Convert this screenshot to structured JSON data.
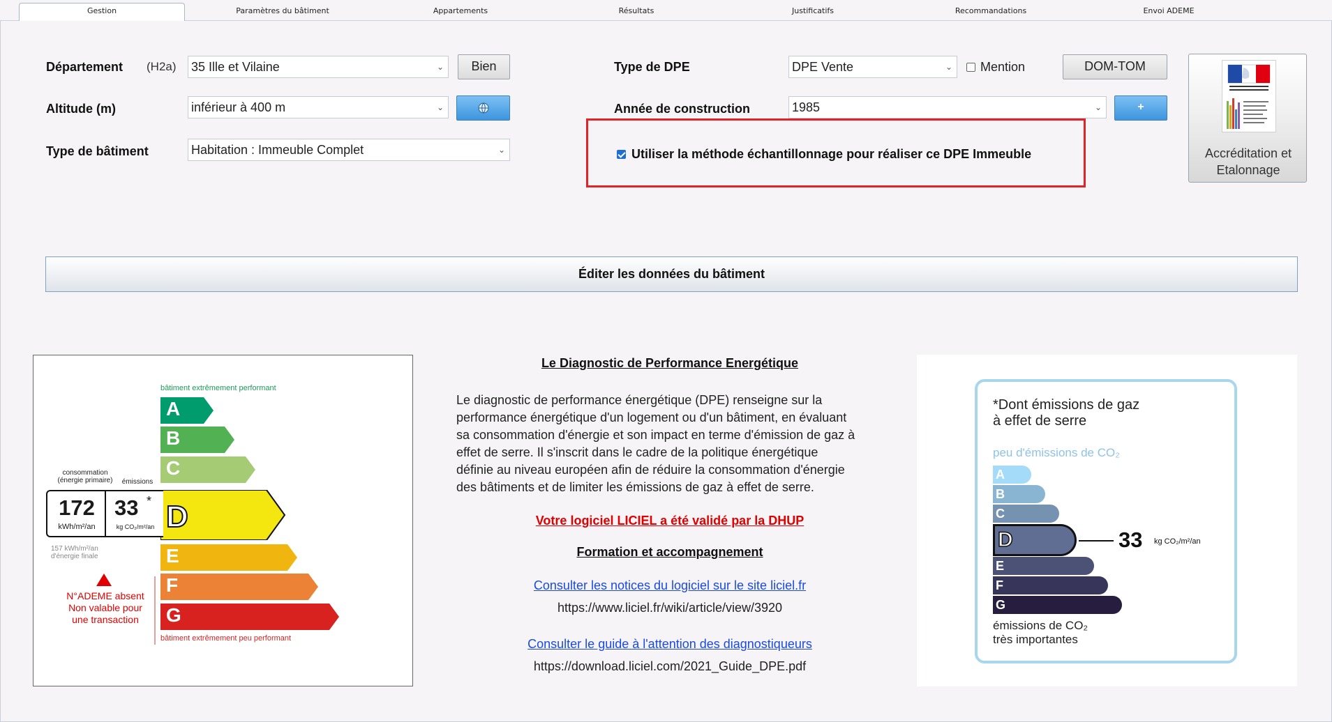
{
  "tabs": [
    "Gestion",
    "Paramètres du bâtiment",
    "Appartements",
    "Résultats",
    "Justificatifs",
    "Recommandations",
    "Envoi ADEME"
  ],
  "form": {
    "departement_label": "Département",
    "zone": "(H2a)",
    "departement_value": "35  Ille et Vilaine",
    "bien_button": "Bien",
    "altitude_label": "Altitude (m)",
    "altitude_value": "inférieur à 400 m",
    "type_batiment_label": "Type de bâtiment",
    "type_batiment_value": "Habitation : Immeuble Complet",
    "type_dpe_label": "Type de DPE",
    "type_dpe_value": "DPE Vente",
    "mention_label": "Mention",
    "domtom_button": "DOM-TOM",
    "annee_label": "Année de construction",
    "annee_value": "1985",
    "plus_button": "+",
    "echantillonnage_label": "Utiliser la méthode échantillonnage pour réaliser ce DPE Immeuble",
    "accreditation_label_1": "Accréditation et",
    "accreditation_label_2": "Etalonnage",
    "edit_button": "Éditer les données du bâtiment"
  },
  "energy_label": {
    "top_text": "bâtiment extrêmement performant",
    "bottom_text": "bâtiment extrêmement peu performant",
    "col1_line1": "consommation",
    "col1_line2": "(énergie primaire)",
    "col2_label": "émissions",
    "consumption": "172",
    "consumption_unit": "kWh/m²/an",
    "emissions": "33",
    "emissions_star": "*",
    "emissions_unit": "kg CO₂/m²/an",
    "final_line1": "157 kWh/m²/an",
    "final_line2": "d'énergie finale",
    "ademe_line1": "N°ADEME absent",
    "ademe_line2": "Non valable pour",
    "ademe_line3": "une transaction",
    "class": "D",
    "grades": [
      {
        "letter": "A",
        "color": "#009c6d"
      },
      {
        "letter": "B",
        "color": "#52b153"
      },
      {
        "letter": "C",
        "color": "#a5cc74"
      },
      {
        "letter": "D",
        "color": "#f4e70f"
      },
      {
        "letter": "E",
        "color": "#f0b50f"
      },
      {
        "letter": "F",
        "color": "#eb8235"
      },
      {
        "letter": "G",
        "color": "#d7221f"
      }
    ]
  },
  "info": {
    "title": "Le Diagnostic de Performance Energétique",
    "paragraph": [
      "Le diagnostic de performance énergétique (DPE) renseigne sur la",
      "performance énergétique d'un logement ou d'un bâtiment, en évaluant",
      "sa consommation d'énergie et son impact en terme d'émission de gaz à",
      "effet de serre. Il s'inscrit dans le cadre de la politique énergétique",
      "définie au niveau européen afin de réduire la consommation d'énergie",
      "des bâtiments et de limiter les émissions de gaz à effet de serre."
    ],
    "validated": "Votre logiciel LICIEL a été validé par la DHUP",
    "formation": "Formation et accompagnement",
    "link1": "Consulter les notices du logiciel sur le site liciel.fr",
    "url1": "https://www.liciel.fr/wiki/article/view/3920",
    "link2": "Consulter le guide à l'attention des diagnostiqueurs",
    "url2": "https://download.liciel.com/2021_Guide_DPE.pdf"
  },
  "ges_label": {
    "title_line1": "*Dont émissions de gaz",
    "title_line2": "à effet de serre",
    "top_text": "peu d'émissions de CO₂",
    "bottom_line1": "émissions de CO₂",
    "bottom_line2": "très importantes",
    "value": "33",
    "unit": "kg CO₂/m²/an",
    "class": "D",
    "grades": [
      {
        "letter": "A",
        "color": "#a4dbf8"
      },
      {
        "letter": "B",
        "color": "#8ab5d2"
      },
      {
        "letter": "C",
        "color": "#7692b1"
      },
      {
        "letter": "D",
        "color": "#5f6e92"
      },
      {
        "letter": "E",
        "color": "#4c5176"
      },
      {
        "letter": "F",
        "color": "#37365a"
      },
      {
        "letter": "G",
        "color": "#271d3e"
      }
    ]
  }
}
